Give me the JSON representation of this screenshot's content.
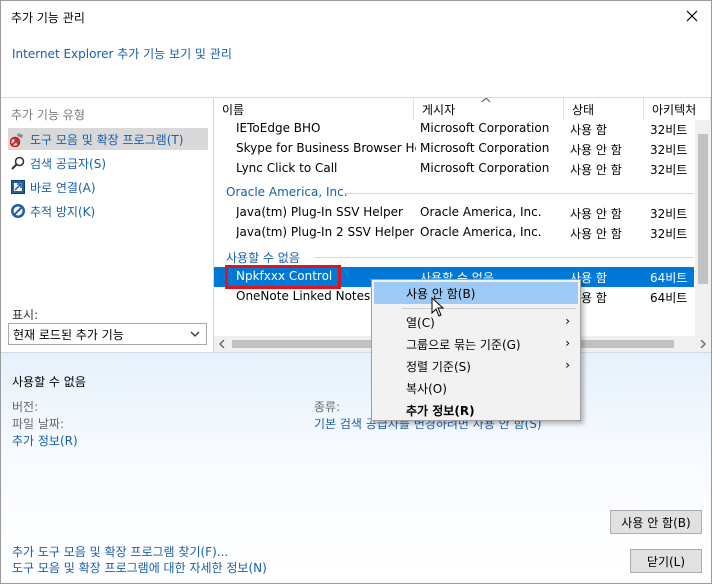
{
  "window": {
    "title": "추가 기능 관리"
  },
  "header": {
    "link": "Internet Explorer 추가 기능 보기 및 관리"
  },
  "left": {
    "heading": "추가 기능 유형",
    "types": [
      {
        "label": "도구 모음 및 확장 프로그램(T)",
        "icon": "toolbar-extension-icon"
      },
      {
        "label": "검색 공급자(S)",
        "icon": "search-icon"
      },
      {
        "label": "바로 연결(A)",
        "icon": "accelerator-icon"
      },
      {
        "label": "추적 방지(K)",
        "icon": "tracking-protection-icon"
      }
    ],
    "show_label": "표시:",
    "show_value": "현재 로드된 추가 기능"
  },
  "list": {
    "columns": [
      "이름",
      "게시자",
      "상태",
      "아키텍처"
    ],
    "rows_top": [
      {
        "name": "IEToEdge BHO",
        "publisher": "Microsoft Corporation",
        "status": "사용 함",
        "arch": "32비트"
      },
      {
        "name": "Skype for Business Browser He...",
        "publisher": "Microsoft Corporation",
        "status": "사용 안 함",
        "arch": "32비트"
      },
      {
        "name": "Lync Click to Call",
        "publisher": "Microsoft Corporation",
        "status": "사용 안 함",
        "arch": "32비트"
      }
    ],
    "groups": [
      {
        "title": "Oracle America, Inc.",
        "rows": [
          {
            "name": "Java(tm) Plug-In SSV Helper",
            "publisher": "Oracle America, Inc.",
            "status": "사용 안 함",
            "arch": "32비트"
          },
          {
            "name": "Java(tm) Plug-In 2 SSV Helper",
            "publisher": "Oracle America, Inc.",
            "status": "사용 안 함",
            "arch": "32비트"
          }
        ]
      },
      {
        "title": "사용할 수 없음",
        "rows": [
          {
            "name": "Npkfxxx Control",
            "publisher": "사용할 수 없음",
            "status": "사용 함",
            "arch": "64비트",
            "selected": true
          },
          {
            "name": "OneNote Linked Notes",
            "publisher": "",
            "status": "사용 함",
            "arch": "64비트"
          }
        ]
      }
    ]
  },
  "context_menu": {
    "items": [
      {
        "label": "사용 안 함(B)"
      },
      {
        "label": "열(C)"
      },
      {
        "label": "그룹으로 묶는 기준(G)"
      },
      {
        "label": "정렬 기준(S)"
      },
      {
        "label": "복사(O)"
      },
      {
        "label": "추가 정보(R)"
      }
    ]
  },
  "details": {
    "title": "사용할 수 없음",
    "version_label": "버전:",
    "date_label": "파일 날짜:",
    "more_info": "추가 정보(R)",
    "type_label": "종류:",
    "type_value": "기본 검색 공급자를 변경하려면 사용 안 함(S)",
    "disable_button": "사용 안 함(B)",
    "close_button": "닫기(L)",
    "footer_links": [
      "추가 도구 모음 및 확장 프로그램 찾기(F)...",
      "도구 모음 및 확장 프로그램에 대한 자세한 정보(N)"
    ]
  },
  "colors": {
    "accent": "#0078d7",
    "link": "#1a5eaa",
    "highlight": "#e0141e"
  }
}
